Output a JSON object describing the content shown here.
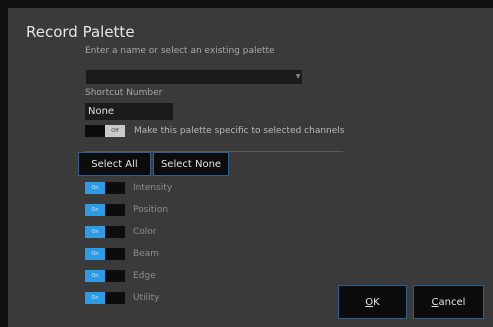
{
  "dialog": {
    "title": "Record Palette",
    "name_prompt": "Enter a name or select an existing palette",
    "name_value": "",
    "shortcut_label": "Shortcut Number",
    "shortcut_value": "None",
    "specific_toggle": {
      "state_label": "Off",
      "is_on": false,
      "text": "Make this palette specific to selected channels"
    },
    "select_all_label": "Select All",
    "select_none_label": "Select None",
    "categories": [
      {
        "name": "Intensity",
        "state_label": "On",
        "is_on": true
      },
      {
        "name": "Position",
        "state_label": "On",
        "is_on": true
      },
      {
        "name": "Color",
        "state_label": "On",
        "is_on": true
      },
      {
        "name": "Beam",
        "state_label": "On",
        "is_on": true
      },
      {
        "name": "Edge",
        "state_label": "On",
        "is_on": true
      },
      {
        "name": "Utility",
        "state_label": "On",
        "is_on": true
      }
    ],
    "ok_label": "OK",
    "ok_mnemonic": "O",
    "ok_rest": "K",
    "cancel_label": "Cancel",
    "cancel_mnemonic": "C",
    "cancel_rest": "ancel",
    "accent_color": "#2d9be6",
    "button_border_color": "#2f5f8f"
  }
}
